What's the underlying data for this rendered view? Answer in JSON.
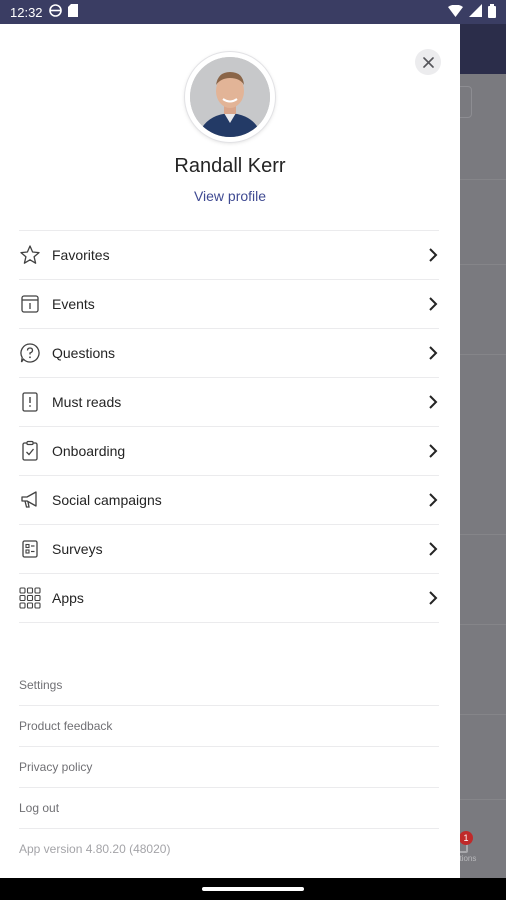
{
  "status_bar": {
    "time": "12:32",
    "icons_left": [
      "vpn-icon",
      "sd-card-icon"
    ],
    "icons_right": [
      "wifi-icon",
      "signal-icon",
      "battery-icon"
    ]
  },
  "drawer": {
    "user_name": "Randall Kerr",
    "view_profile_label": "View profile",
    "menu_items": [
      {
        "label": "Favorites",
        "icon": "star-icon"
      },
      {
        "label": "Events",
        "icon": "calendar-icon"
      },
      {
        "label": "Questions",
        "icon": "question-icon"
      },
      {
        "label": "Must reads",
        "icon": "must-read-icon"
      },
      {
        "label": "Onboarding",
        "icon": "clipboard-check-icon"
      },
      {
        "label": "Social campaigns",
        "icon": "megaphone-icon"
      },
      {
        "label": "Surveys",
        "icon": "survey-icon"
      },
      {
        "label": "Apps",
        "icon": "apps-grid-icon"
      }
    ],
    "footer_links": [
      {
        "label": "Settings"
      },
      {
        "label": "Product feedback"
      },
      {
        "label": "Privacy policy"
      },
      {
        "label": "Log out"
      }
    ],
    "app_version": "App version 4.80.20 (48020)"
  },
  "background": {
    "badge_count": "1",
    "tab_label_partial": "ations"
  },
  "colors": {
    "status_bar": "#3a3d63",
    "link": "#3f4a92",
    "badge": "#c02a2a"
  }
}
